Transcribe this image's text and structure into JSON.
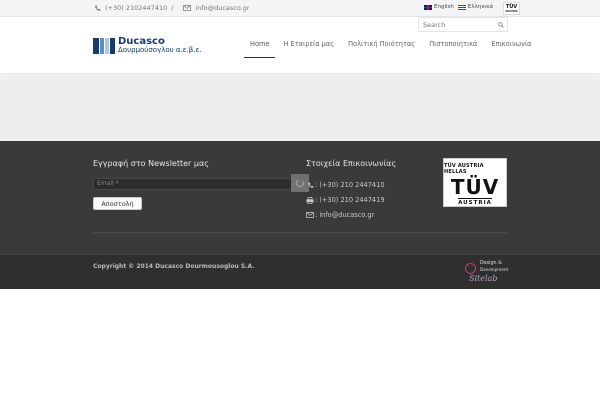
{
  "topbar": {
    "phone": "(+30) 2102447410",
    "separator": "/",
    "email": "info@ducasco.gr",
    "lang_en": "English",
    "lang_gr": "Ελληνικά",
    "tuv_label": "TÜV",
    "tuv_sub": "AUSTRIA"
  },
  "search": {
    "placeholder": "Search"
  },
  "logo": {
    "line1": "Ducasco",
    "line2": "Δουρμούσογλου α.ε.β.ε."
  },
  "nav": {
    "items": [
      {
        "label": "Home",
        "active": true
      },
      {
        "label": "Η Εταιρεία μας"
      },
      {
        "label": "Πολιτική Ποιότητας"
      },
      {
        "label": "Πιστοποιητικά"
      },
      {
        "label": "Επικοινωνία"
      }
    ]
  },
  "footer": {
    "newsletter_title": "Εγγραφή στο Newsletter μας",
    "email_placeholder": "Email *",
    "submit_label": "Αποστολή",
    "contact_title": "Στοιχεία Επικοινωνίας",
    "phone": ": (+30) 210 2447410",
    "fax": ": (+30) 210 2447419",
    "email": ": info@ducasco.gr",
    "badge_line1": "TÜV AUSTRIA HELLAS",
    "badge_line2": "TÜV",
    "badge_line3": "AUSTRIA"
  },
  "bottom": {
    "copyright": "Copyright © 2014 Ducasco Dourmousoglou S.A.",
    "credit_line1": "Design &",
    "credit_line2": "Development",
    "credit_brand": "Sitelab"
  },
  "colors": {
    "footer_bg": "#3a3a3a",
    "bottom_bg": "#2f2f2f",
    "logo_blue": "#1a3a6b",
    "strip_gray": "#eeeeee"
  }
}
